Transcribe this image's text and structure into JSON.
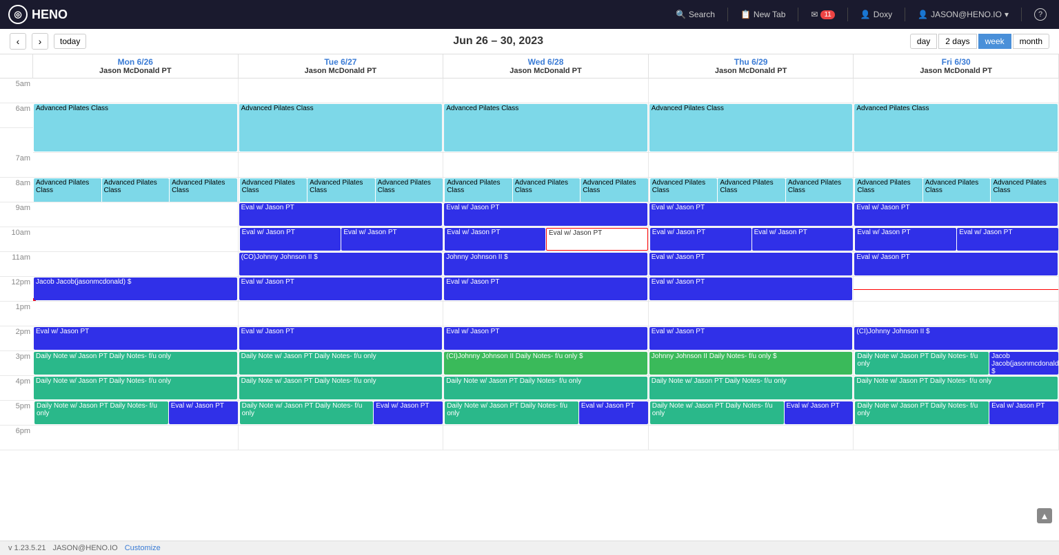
{
  "app": {
    "logo_text": "HENO",
    "logo_icon": "◎"
  },
  "topnav": {
    "search_label": "Search",
    "new_tab_label": "New Tab",
    "messages_label": "11",
    "doxy_label": "Doxy",
    "user_label": "JASON@HENO.IO",
    "help_label": "?"
  },
  "toolbar": {
    "today_label": "today",
    "title": "Jun 26 – 30, 2023",
    "view_day": "day",
    "view_2days": "2 days",
    "view_week": "week",
    "view_month": "month",
    "active_view": "week"
  },
  "days": [
    {
      "name": "Mon 6/26",
      "provider": "Jason McDonald PT"
    },
    {
      "name": "Tue 6/27",
      "provider": "Jason McDonald PT"
    },
    {
      "name": "Wed 6/28",
      "provider": "Jason McDonald PT"
    },
    {
      "name": "Thu 6/29",
      "provider": "Jason McDonald PT"
    },
    {
      "name": "Fri 6/30",
      "provider": "Jason McDonald PT"
    }
  ],
  "time_slots": [
    "5am",
    "6am",
    "7am",
    "8am",
    "9am",
    "10am",
    "11am",
    "12pm",
    "1pm",
    "2pm",
    "3pm",
    "4pm",
    "5pm",
    "6pm"
  ],
  "footer": {
    "version": "v 1.23.5.21",
    "user": "JASON@HENO.IO",
    "customize": "Customize"
  }
}
